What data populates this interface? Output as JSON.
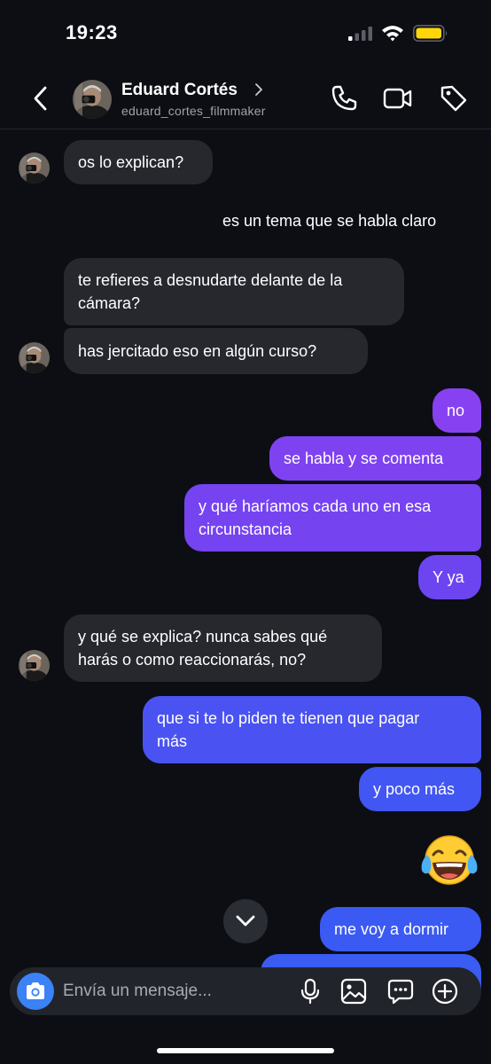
{
  "status_bar": {
    "time": "19:23",
    "signal_icon": "cellular-signal-icon",
    "wifi_icon": "wifi-icon",
    "battery_icon": "battery-low-icon",
    "battery_color": "#ffd60a"
  },
  "header": {
    "name": "Eduard Cortés",
    "username": "eduard_cortes_filmmaker",
    "icons": [
      "back-arrow-icon",
      "phone-icon",
      "video-camera-icon",
      "tag-icon"
    ]
  },
  "colors": {
    "background": "#0c0e14",
    "incoming_bubble": "#26282e",
    "outgoing_purple": "#8b3ef0",
    "outgoing_blue": "#3d5af2",
    "accent_blue": "#3b82f6"
  },
  "messages": [
    {
      "direction": "in",
      "text": "os lo explican?"
    },
    {
      "direction": "out",
      "text": "es un tema que se habla claro"
    },
    {
      "direction": "in",
      "lines": [
        "te refieres a desnudarte delante de la",
        "cámara?"
      ]
    },
    {
      "direction": "in",
      "text": "has jercitado eso en algún curso?"
    },
    {
      "direction": "out",
      "text": "no"
    },
    {
      "direction": "out",
      "text": "se habla y se comenta"
    },
    {
      "direction": "out",
      "lines": [
        "y qué haríamos cada uno en esa",
        "circunstancia"
      ]
    },
    {
      "direction": "out",
      "text": "Y ya"
    },
    {
      "direction": "in",
      "lines": [
        "y qué se explica? nunca sabes qué",
        "harás o como reaccionarás, no?"
      ]
    },
    {
      "direction": "out",
      "lines": [
        "que si te lo piden te tienen que pagar",
        "más"
      ]
    },
    {
      "direction": "out",
      "text": "y poco más"
    },
    {
      "direction": "out",
      "emoji": "face-with-tears-of-joy"
    },
    {
      "direction": "out",
      "text": "me voy a dormir"
    }
  ],
  "composer": {
    "placeholder": "Envía un mensaje...",
    "icons": [
      "camera-icon",
      "microphone-icon",
      "gallery-icon",
      "sticker-chat-icon",
      "plus-circle-icon"
    ]
  },
  "scroll_button_icon": "chevron-down-icon"
}
